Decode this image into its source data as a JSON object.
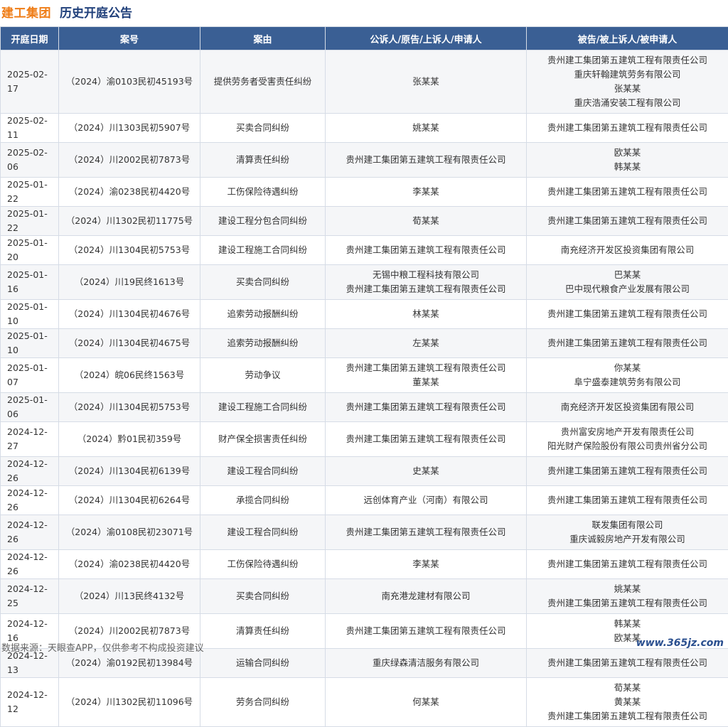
{
  "header": {
    "brand": "建工集团",
    "title": "历史开庭公告"
  },
  "table": {
    "columns": [
      "开庭日期",
      "案号",
      "案由",
      "公诉人/原告/上诉人/申请人",
      "被告/被上诉人/被申请人"
    ],
    "rows": [
      {
        "date": "2025-02-17",
        "case_no": "（2024）渝0103民初45193号",
        "cause": "提供劳务者受害责任纠纷",
        "plaintiffs": [
          "张某某"
        ],
        "defendants": [
          "贵州建工集团第五建筑工程有限责任公司",
          "重庆轩翰建筑劳务有限公司",
          "张某某",
          "重庆浩涌安装工程有限公司"
        ]
      },
      {
        "date": "2025-02-11",
        "case_no": "（2024）川1303民初5907号",
        "cause": "买卖合同纠纷",
        "plaintiffs": [
          "姚某某"
        ],
        "defendants": [
          "贵州建工集团第五建筑工程有限责任公司"
        ]
      },
      {
        "date": "2025-02-06",
        "case_no": "（2024）川2002民初7873号",
        "cause": "清算责任纠纷",
        "plaintiffs": [
          "贵州建工集团第五建筑工程有限责任公司"
        ],
        "defendants": [
          "欧某某",
          "韩某某"
        ]
      },
      {
        "date": "2025-01-22",
        "case_no": "（2024）渝0238民初4420号",
        "cause": "工伤保险待遇纠纷",
        "plaintiffs": [
          "李某某"
        ],
        "defendants": [
          "贵州建工集团第五建筑工程有限责任公司"
        ]
      },
      {
        "date": "2025-01-22",
        "case_no": "（2024）川1302民初11775号",
        "cause": "建设工程分包合同纠纷",
        "plaintiffs": [
          "荀某某"
        ],
        "defendants": [
          "贵州建工集团第五建筑工程有限责任公司"
        ]
      },
      {
        "date": "2025-01-20",
        "case_no": "（2024）川1304民初5753号",
        "cause": "建设工程施工合同纠纷",
        "plaintiffs": [
          "贵州建工集团第五建筑工程有限责任公司"
        ],
        "defendants": [
          "南充经济开发区投资集团有限公司"
        ]
      },
      {
        "date": "2025-01-16",
        "case_no": "（2024）川19民终1613号",
        "cause": "买卖合同纠纷",
        "plaintiffs": [
          "无锡中粮工程科技有限公司",
          "贵州建工集团第五建筑工程有限责任公司"
        ],
        "defendants": [
          "巴某某",
          "巴中现代粮食产业发展有限公司"
        ]
      },
      {
        "date": "2025-01-10",
        "case_no": "（2024）川1304民初4676号",
        "cause": "追索劳动报酬纠纷",
        "plaintiffs": [
          "林某某"
        ],
        "defendants": [
          "贵州建工集团第五建筑工程有限责任公司"
        ]
      },
      {
        "date": "2025-01-10",
        "case_no": "（2024）川1304民初4675号",
        "cause": "追索劳动报酬纠纷",
        "plaintiffs": [
          "左某某"
        ],
        "defendants": [
          "贵州建工集团第五建筑工程有限责任公司"
        ]
      },
      {
        "date": "2025-01-07",
        "case_no": "（2024）皖06民终1563号",
        "cause": "劳动争议",
        "plaintiffs": [
          "贵州建工集团第五建筑工程有限责任公司",
          "董某某"
        ],
        "defendants": [
          "你某某",
          "阜宁盛泰建筑劳务有限公司"
        ]
      },
      {
        "date": "2025-01-06",
        "case_no": "（2024）川1304民初5753号",
        "cause": "建设工程施工合同纠纷",
        "plaintiffs": [
          "贵州建工集团第五建筑工程有限责任公司"
        ],
        "defendants": [
          "南充经济开发区投资集团有限公司"
        ]
      },
      {
        "date": "2024-12-27",
        "case_no": "（2024）黔01民初359号",
        "cause": "财产保全损害责任纠纷",
        "plaintiffs": [
          "贵州建工集团第五建筑工程有限责任公司"
        ],
        "defendants": [
          "贵州富安房地产开发有限责任公司",
          "阳光财产保险股份有限公司贵州省分公司"
        ]
      },
      {
        "date": "2024-12-26",
        "case_no": "（2024）川1304民初6139号",
        "cause": "建设工程合同纠纷",
        "plaintiffs": [
          "史某某"
        ],
        "defendants": [
          "贵州建工集团第五建筑工程有限责任公司"
        ]
      },
      {
        "date": "2024-12-26",
        "case_no": "（2024）川1304民初6264号",
        "cause": "承揽合同纠纷",
        "plaintiffs": [
          "远创体育产业（河南）有限公司"
        ],
        "defendants": [
          "贵州建工集团第五建筑工程有限责任公司"
        ]
      },
      {
        "date": "2024-12-26",
        "case_no": "（2024）渝0108民初23071号",
        "cause": "建设工程合同纠纷",
        "plaintiffs": [
          "贵州建工集团第五建筑工程有限责任公司"
        ],
        "defendants": [
          "联发集团有限公司",
          "重庆诚毅房地产开发有限公司"
        ]
      },
      {
        "date": "2024-12-26",
        "case_no": "（2024）渝0238民初4420号",
        "cause": "工伤保险待遇纠纷",
        "plaintiffs": [
          "李某某"
        ],
        "defendants": [
          "贵州建工集团第五建筑工程有限责任公司"
        ]
      },
      {
        "date": "2024-12-25",
        "case_no": "（2024）川13民终4132号",
        "cause": "买卖合同纠纷",
        "plaintiffs": [
          "南充港龙建材有限公司"
        ],
        "defendants": [
          "姚某某",
          "贵州建工集团第五建筑工程有限责任公司"
        ]
      },
      {
        "date": "2024-12-16",
        "case_no": "（2024）川2002民初7873号",
        "cause": "清算责任纠纷",
        "plaintiffs": [
          "贵州建工集团第五建筑工程有限责任公司"
        ],
        "defendants": [
          "韩某某",
          "欧某某"
        ]
      },
      {
        "date": "2024-12-13",
        "case_no": "（2024）渝0192民初13984号",
        "cause": "运输合同纠纷",
        "plaintiffs": [
          "重庆绿森清洁服务有限公司"
        ],
        "defendants": [
          "贵州建工集团第五建筑工程有限责任公司"
        ]
      },
      {
        "date": "2024-12-12",
        "case_no": "（2024）川1302民初11096号",
        "cause": "劳务合同纠纷",
        "plaintiffs": [
          "何某某"
        ],
        "defendants": [
          "荀某某",
          "黄某某",
          "贵州建工集团第五建筑工程有限责任公司"
        ]
      }
    ]
  },
  "footer": {
    "source": "数据来源：天眼查APP，仅供参考不构成投资建议",
    "site": "www.365jz.com"
  }
}
